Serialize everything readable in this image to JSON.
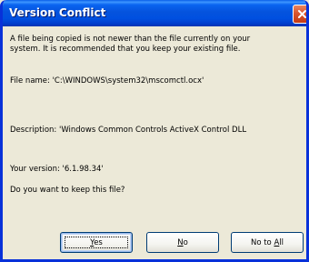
{
  "dialog": {
    "title": "Version Conflict",
    "message_line1": "A file being copied is not newer than the file currently on your",
    "message_line2": "system. It is recommended that you keep your existing file.",
    "file_name_line": "File name:   'C:\\WINDOWS\\system32\\mscomctl.ocx'",
    "description_line": "Description:  'Windows Common Controls ActiveX Control DLL",
    "your_version_line": "Your version:  '6.1.98.34'",
    "question": "Do you want to keep this file?"
  },
  "buttons": {
    "yes": {
      "mnemonic": "Y",
      "rest": "es"
    },
    "no": {
      "mnemonic": "N",
      "rest": "o"
    },
    "no_to_all": {
      "prefix": "No to ",
      "mnemonic": "A",
      "rest": "ll"
    }
  },
  "colors": {
    "titlebar": "#0553dd",
    "frame": "#0831d9",
    "dialog_background": "#ece9d8",
    "close_button": "#d9552e",
    "button_border": "#003c74"
  },
  "icons": {
    "close": "close-icon"
  }
}
